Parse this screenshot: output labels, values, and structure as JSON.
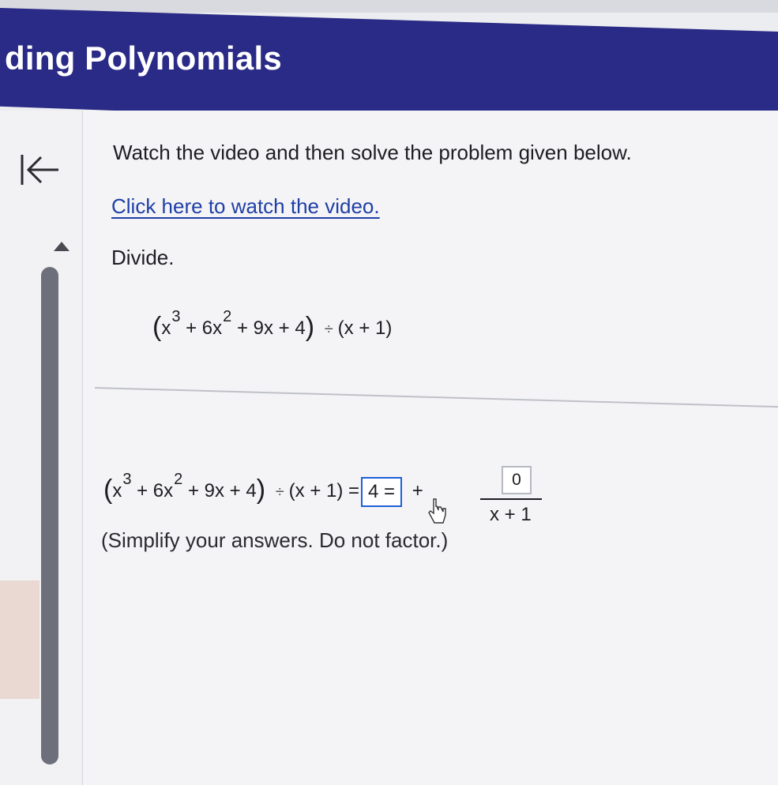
{
  "header": {
    "title": "ding Polynomials"
  },
  "nav": {
    "back_icon": "arrow-left-bar-icon",
    "scroll_up_icon": "triangle-up-icon"
  },
  "content": {
    "instruction": "Watch the video and then solve the problem given below.",
    "video_link": "Click here to watch the video.",
    "prompt_label": "Divide."
  },
  "problem": {
    "x_term": "x",
    "x_exp": "3",
    "quad_term": "+ 6x",
    "quad_exp": "2",
    "rest_terms": "+ 9x + 4",
    "divide_symbol": "÷",
    "divisor": "(x + 1)"
  },
  "answer": {
    "equals": "=",
    "quotient_value": "4 =",
    "plus": "+",
    "remainder_value": "0",
    "denominator": "x + 1",
    "hint": "(Simplify your answers. Do not factor.)"
  },
  "colors": {
    "header_bg": "#2a2b86",
    "link": "#1f3fa7",
    "active_input_border": "#1f5fd8"
  }
}
